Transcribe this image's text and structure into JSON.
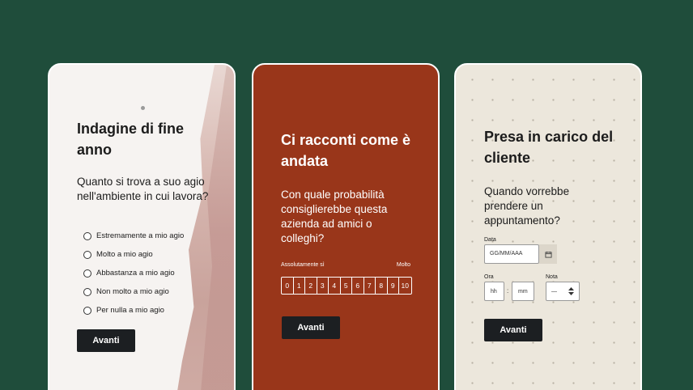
{
  "card1": {
    "title": "Indagine di fine anno",
    "question": "Quanto si trova a suo agio nell'ambiente in cui lavora?",
    "options": [
      "Estremamente a mio agio",
      "Molto a mio agio",
      "Abbastanza a mio agio",
      "Non molto a mio agio",
      "Per nulla a mio agio"
    ],
    "button_label": "Avanti"
  },
  "card2": {
    "title": "Ci racconti come è andata",
    "question": "Con quale probabilità consiglierebbe questa azienda ad amici o colleghi?",
    "scale_low_label": "Assolutamente sì",
    "scale_high_label": "Molto",
    "scale": [
      "0",
      "1",
      "2",
      "3",
      "4",
      "5",
      "6",
      "7",
      "8",
      "9",
      "10"
    ],
    "button_label": "Avanti"
  },
  "card3": {
    "title": "Presa in carico del cliente",
    "question": "Quando vorrebbe prendere un appuntamento?",
    "date_label": "Data",
    "date_placeholder": "GG/MM/AAA",
    "time_label": "Ora",
    "hour_placeholder": "hh",
    "time_separator": ":",
    "minute_placeholder": "mm",
    "note_label": "Nota",
    "note_value": "—",
    "button_label": "Avanti"
  },
  "colors": {
    "background": "#1f4d3b",
    "card2_bg": "#99361a",
    "card3_bg": "#ece7dc",
    "button_bg": "#1c1f22"
  }
}
